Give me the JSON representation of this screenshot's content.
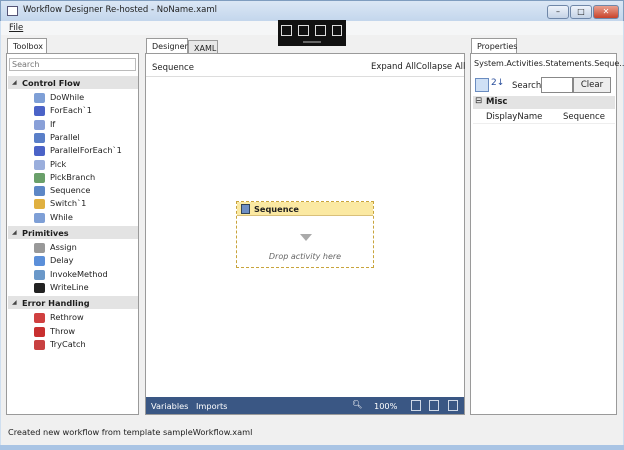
{
  "window": {
    "title": "Workflow Designer Re-hosted - NoName.xaml",
    "minimize": "–",
    "maximize": "□",
    "close": "✕"
  },
  "menu": {
    "file": "File"
  },
  "toolbox": {
    "tab": "Toolbox",
    "search_placeholder": "Search",
    "categories": [
      {
        "name": "Control Flow",
        "items": [
          "DoWhile",
          "ForEach`1",
          "If",
          "Parallel",
          "ParallelForEach`1",
          "Pick",
          "PickBranch",
          "Sequence",
          "Switch`1",
          "While"
        ]
      },
      {
        "name": "Primitives",
        "items": [
          "Assign",
          "Delay",
          "InvokeMethod",
          "WriteLine"
        ]
      },
      {
        "name": "Error Handling",
        "items": [
          "Rethrow",
          "Throw",
          "TryCatch"
        ]
      }
    ]
  },
  "designer": {
    "tabs": [
      "Designer",
      "XAML"
    ],
    "breadcrumb": "Sequence",
    "expand_all": "Expand All",
    "collapse_all": "Collapse All",
    "activity": {
      "title": "Sequence",
      "drop_hint": "Drop activity here"
    },
    "bottom": {
      "variables": "Variables",
      "imports": "Imports",
      "zoom": "100%"
    }
  },
  "properties": {
    "tab": "Properties",
    "type": "System.Activities.Statements.Seque...",
    "search_label": "Search:",
    "search_value": "",
    "clear": "Clear",
    "category": "Misc",
    "category_toggle": "⊟",
    "rows": [
      {
        "name": "DisplayName",
        "value": "Sequence"
      }
    ]
  },
  "status": "Created new workflow from template sampleWorkflow.xaml"
}
